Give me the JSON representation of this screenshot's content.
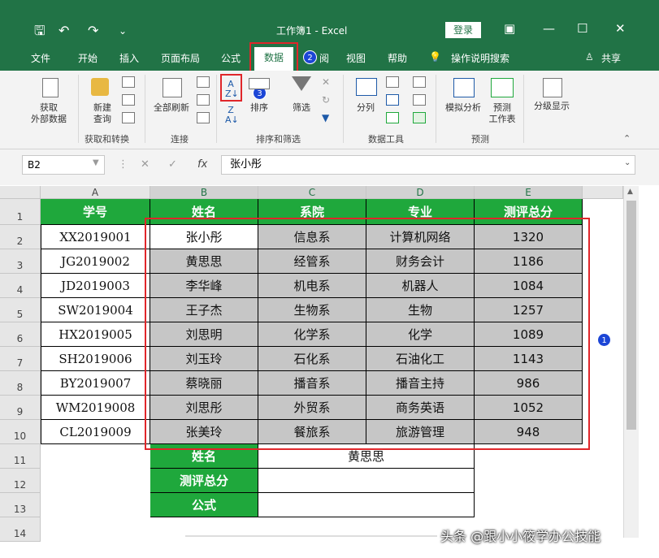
{
  "window": {
    "title": "工作簿1  -  Excel",
    "login_label": "登录",
    "minimize": "—",
    "restore": "☐",
    "close": "✕"
  },
  "quick_access": {
    "save": "🖫",
    "undo": "↶",
    "redo": "↷",
    "more": "⌄"
  },
  "tabs": [
    "文件",
    "开始",
    "插入",
    "页面布局",
    "公式",
    "数据",
    "阅",
    "视图",
    "帮助"
  ],
  "active_tab": "数据",
  "tell_me": "操作说明搜索",
  "share": "共享",
  "ribbon": {
    "get_external": "获取\n外部数据",
    "new_query": "新建\n查询",
    "refresh_all": "全部刷新",
    "sort": "排序",
    "filter": "筛选",
    "text_to_columns": "分列",
    "what_if": "模拟分析",
    "forecast": "预测\n工作表",
    "outline": "分级显示",
    "groups": [
      "获取和转换",
      "连接",
      "排序和筛选",
      "数据工具",
      "预测"
    ]
  },
  "formula_bar": {
    "name_box": "B2",
    "fx": "fx",
    "value": "张小彤"
  },
  "columns": [
    "A",
    "B",
    "C",
    "D",
    "E"
  ],
  "rows": [
    "1",
    "2",
    "3",
    "4",
    "5",
    "6",
    "7",
    "8",
    "9",
    "10",
    "11",
    "12",
    "13",
    "14"
  ],
  "headers": [
    "学号",
    "姓名",
    "系院",
    "专业",
    "测评总分"
  ],
  "data": [
    [
      "XX2019001",
      "张小彤",
      "信息系",
      "计算机网络",
      "1320"
    ],
    [
      "JG2019002",
      "黄思思",
      "经管系",
      "财务会计",
      "1186"
    ],
    [
      "JD2019003",
      "李华峰",
      "机电系",
      "机器人",
      "1084"
    ],
    [
      "SW2019004",
      "王子杰",
      "生物系",
      "生物",
      "1257"
    ],
    [
      "HX2019005",
      "刘思明",
      "化学系",
      "化学",
      "1089"
    ],
    [
      "SH2019006",
      "刘玉玲",
      "石化系",
      "石油化工",
      "1143"
    ],
    [
      "BY2019007",
      "蔡晓丽",
      "播音系",
      "播音主持",
      "986"
    ],
    [
      "WM2019008",
      "刘思彤",
      "外贸系",
      "商务英语",
      "1052"
    ],
    [
      "CL2019009",
      "张美玲",
      "餐旅系",
      "旅游管理",
      "948"
    ]
  ],
  "lookup": [
    {
      "label": "姓名",
      "value": "黄思思"
    },
    {
      "label": "测评总分",
      "value": ""
    },
    {
      "label": "公式",
      "value": ""
    }
  ],
  "badges": [
    "2",
    "3",
    "1"
  ],
  "watermark": "头条 @跟小小筱学办公技能"
}
